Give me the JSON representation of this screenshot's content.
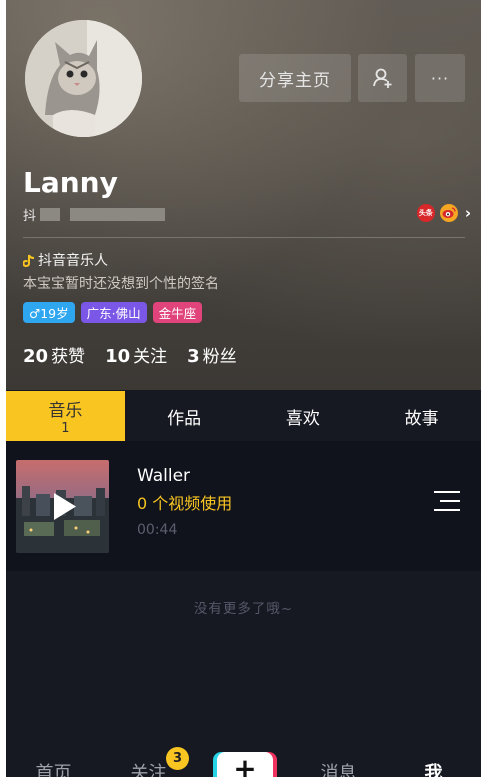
{
  "header": {
    "share_label": "分享主页",
    "more_label": "···",
    "name": "Lanny",
    "id_prefix": "抖",
    "toutiao_label": "头条",
    "musician_label": "抖音音乐人",
    "bio": "本宝宝暂时还没想到个性的签名",
    "tags": {
      "age": "♂19岁",
      "location": "广东·佛山",
      "zodiac": "金牛座"
    },
    "stats": {
      "likes_count": "20",
      "likes_label": "获赞",
      "following_count": "10",
      "following_label": "关注",
      "followers_count": "3",
      "followers_label": "粉丝"
    }
  },
  "tabs": {
    "music_label": "音乐",
    "music_count": "1",
    "works_label": "作品",
    "likes_label": "喜欢",
    "story_label": "故事"
  },
  "track": {
    "title": "Waller",
    "usage": "0 个视频使用",
    "duration": "00:44"
  },
  "no_more_text": "没有更多了哦~",
  "nav": {
    "home": "首页",
    "follow": "关注",
    "follow_badge": "3",
    "plus": "+",
    "messages": "消息",
    "me": "我"
  },
  "colors": {
    "accent_yellow": "#f9c521",
    "background": "#161822"
  }
}
